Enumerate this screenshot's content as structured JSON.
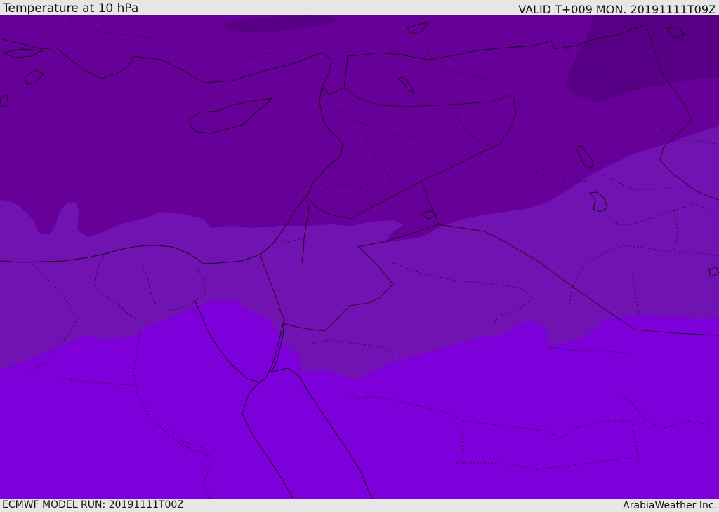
{
  "header": {
    "title": "Temperature at 10 hPa",
    "valid": "VALID T+009 MON. 20191111T09Z"
  },
  "footer": {
    "model_run": "ECMWF MODEL RUN: 20191111T00Z",
    "credit": "ArabiaWeather Inc."
  },
  "map": {
    "colors": {
      "band_coldest": "#580085",
      "band_cold": "#660099",
      "band_mid": "#7112b3",
      "band_warm": "#7d00db",
      "coast": "#1a0a1a",
      "border": "#2a0a2a"
    }
  }
}
